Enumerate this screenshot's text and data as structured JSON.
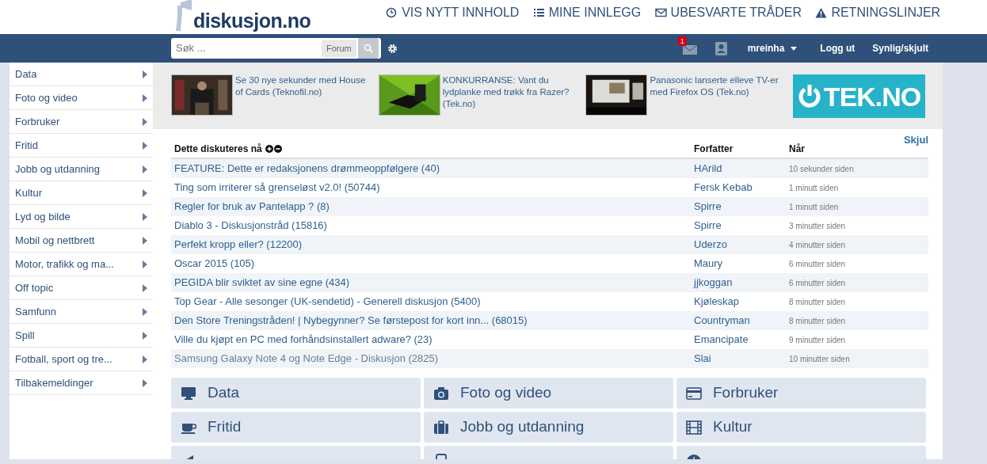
{
  "header": {
    "logo": "diskusjon.no",
    "links": [
      "VIS NYTT INNHOLD",
      "MINE INNLEGG",
      "UBESVARTE TRÅDER",
      "RETNINGSLINJER"
    ]
  },
  "navbar": {
    "search": {
      "placeholder": "Søk ...",
      "scope": "Forum"
    },
    "message_count": "1",
    "user": "mreinha",
    "links": [
      "Logg ut",
      "Synlig/skjult"
    ]
  },
  "sidebar": {
    "items": [
      "Data",
      "Foto og video",
      "Forbruker",
      "Fritid",
      "Jobb og utdanning",
      "Kultur",
      "Lyd og bilde",
      "Mobil og nettbrett",
      "Motor, trafikk og ma...",
      "Off topic",
      "Samfunn",
      "Spill",
      "Fotball, sport og tre...",
      "Tilbakemeldinger"
    ]
  },
  "promos": {
    "items": [
      {
        "text": "Se 30 nye sekunder med House of Cards (Teknofil.no)"
      },
      {
        "text": "KONKURRANSE: Vant du lydplanke med trøkk fra Razer? (Tek.no)"
      },
      {
        "text": "Panasonic lanserte elleve TV-er med Firefox OS (Tek.no)"
      }
    ],
    "brand": "TEK.NO"
  },
  "discussions": {
    "title": "Dette diskuteres nå",
    "columns": [
      "Forfatter",
      "Når"
    ],
    "hide": "Skjul",
    "rows": [
      {
        "topic": "FEATURE: Dette er redaksjonens drømmeoppfølgere (40)",
        "author": "HArild",
        "time": "10 sekunder siden",
        "visited": false
      },
      {
        "topic": "Ting som irriterer så grenseløst v2.0! (50744)",
        "author": "Fersk Kebab",
        "time": "1 minutt siden",
        "visited": false
      },
      {
        "topic": "Regler for bruk av Pantelapp ? (8)",
        "author": "Spirre",
        "time": "1 minutt siden",
        "visited": false
      },
      {
        "topic": "Diablo 3 - Diskusjonstråd (15816)",
        "author": "Spirre",
        "time": "3 minutter siden",
        "visited": false
      },
      {
        "topic": "Perfekt kropp eller? (12200)",
        "author": "Uderzo",
        "time": "4 minutter siden",
        "visited": false
      },
      {
        "topic": "Oscar 2015 (105)",
        "author": "Maury",
        "time": "6 minutter siden",
        "visited": false
      },
      {
        "topic": "PEGIDA blir sviktet av sine egne (434)",
        "author": "jjkoggan",
        "time": "6 minutter siden",
        "visited": false
      },
      {
        "topic": "Top Gear - Alle sesonger (UK-sendetid) - Generell diskusjon (5400)",
        "author": "Kjøleskap",
        "time": "8 minutter siden",
        "visited": false
      },
      {
        "topic": "Den Store Treningstråden! | Nybegynner? Se førstepost for kort inn... (68015)",
        "author": "Countryman",
        "time": "8 minutter siden",
        "visited": false
      },
      {
        "topic": "Ville du kjøpt en PC med forhåndsinstallert adware? (23)",
        "author": "Emancipate",
        "time": "9 minutter siden",
        "visited": false
      },
      {
        "topic": "Samsung Galaxy Note 4 og Note Edge - Diskusjon (2825)",
        "author": "Slai",
        "time": "10 minutter siden",
        "visited": true
      }
    ]
  },
  "tiles": [
    {
      "kind": "full",
      "label": "Data"
    },
    {
      "kind": "full",
      "label": "Foto og video"
    },
    {
      "kind": "full",
      "label": "Forbruker"
    },
    {
      "kind": "full",
      "label": "Fritid"
    },
    {
      "kind": "full",
      "label": "Jobb og utdanning"
    },
    {
      "kind": "full",
      "label": "Kultur"
    },
    {
      "kind": "cut"
    },
    {
      "kind": "cut"
    },
    {
      "kind": "cut"
    }
  ]
}
